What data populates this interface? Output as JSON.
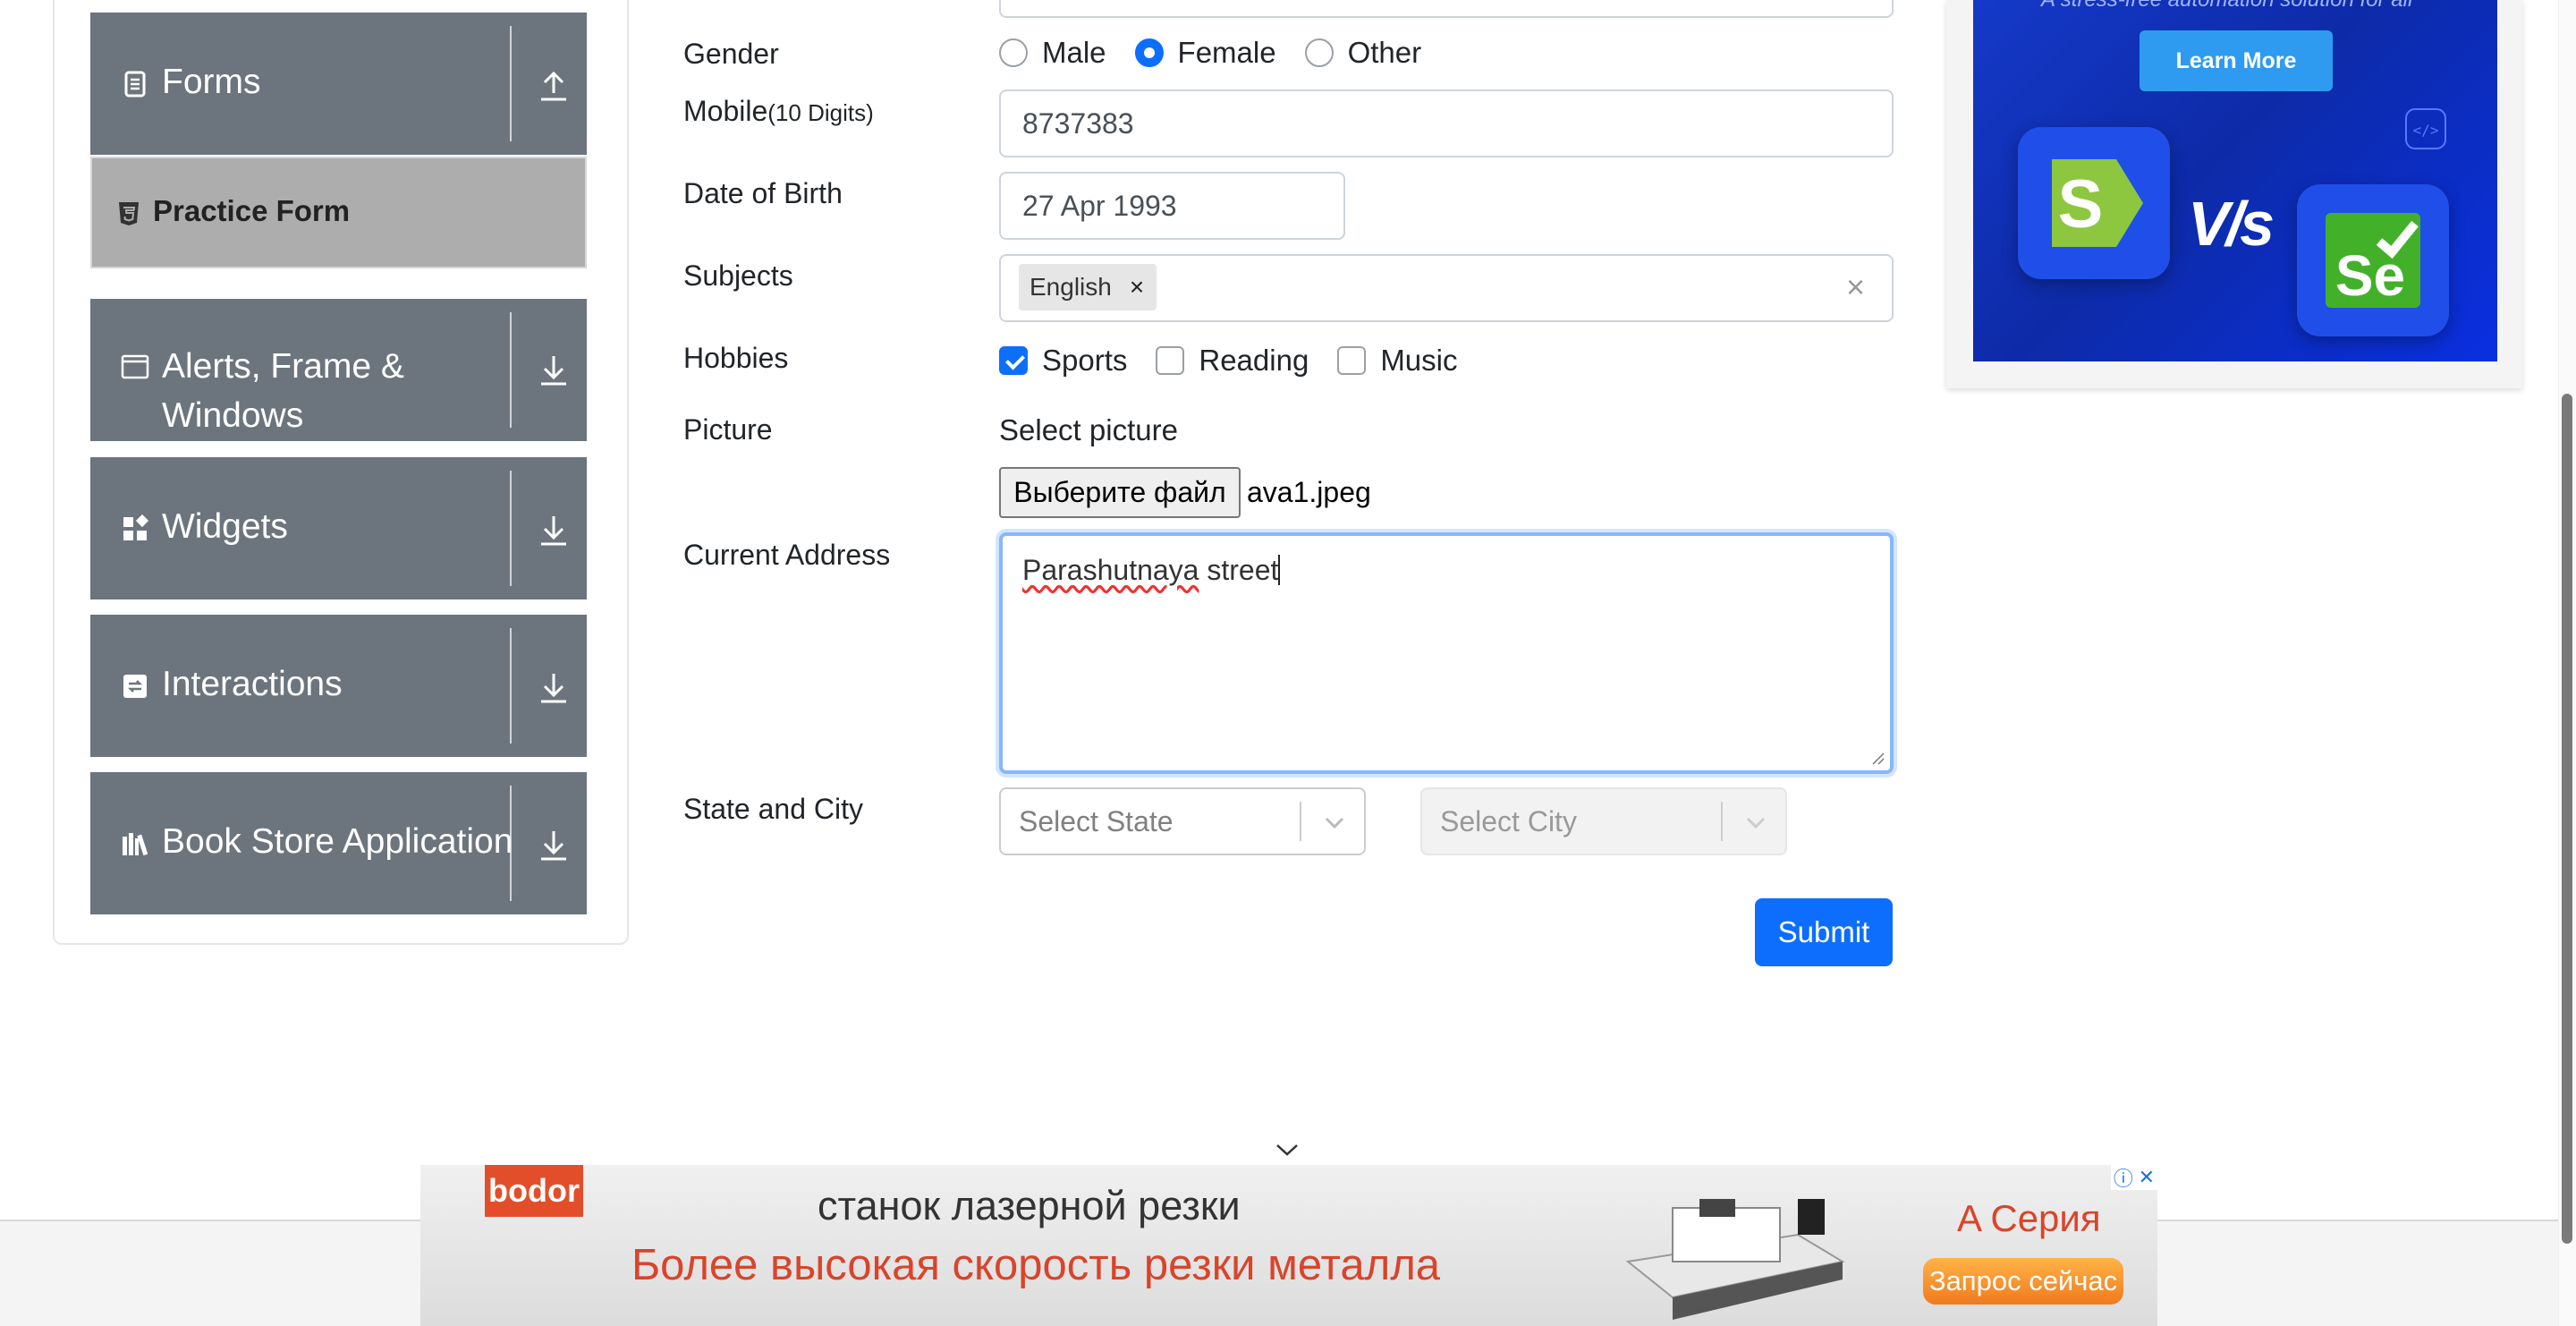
{
  "sidebar": {
    "groups": [
      {
        "id": "forms",
        "label": "Forms",
        "icon": "form-icon",
        "state": "expanded"
      },
      {
        "id": "alerts",
        "label": "Alerts, Frame &",
        "label_line2": "Windows",
        "icon": "window-icon",
        "state": "collapsed"
      },
      {
        "id": "widgets",
        "label": "Widgets",
        "icon": "widgets-icon",
        "state": "collapsed"
      },
      {
        "id": "interactions",
        "label": "Interactions",
        "icon": "interactions-icon",
        "state": "collapsed"
      },
      {
        "id": "bookstore",
        "label": "Book Store Application",
        "icon": "books-icon",
        "state": "collapsed"
      }
    ],
    "active_item": {
      "label": "Practice Form",
      "icon": "html5-icon"
    }
  },
  "form": {
    "gender": {
      "label": "Gender",
      "options": [
        "Male",
        "Female",
        "Other"
      ],
      "selected": "Female"
    },
    "mobile": {
      "label": "Mobile",
      "hint": "(10 Digits)",
      "value": "8737383"
    },
    "dob": {
      "label": "Date of Birth",
      "value": "27 Apr 1993"
    },
    "subjects": {
      "label": "Subjects",
      "chips": [
        "English"
      ],
      "chip_remove": "×",
      "clear": "×"
    },
    "hobbies": {
      "label": "Hobbies",
      "options": [
        {
          "label": "Sports",
          "checked": true
        },
        {
          "label": "Reading",
          "checked": false
        },
        {
          "label": "Music",
          "checked": false
        }
      ]
    },
    "picture": {
      "label": "Picture",
      "prompt": "Select picture",
      "button_label": "Выберите файл",
      "file_name": "ava1.jpeg"
    },
    "address": {
      "label": "Current Address",
      "value_part1": "Parashutnaya",
      "value_part2": " street"
    },
    "state_city": {
      "label": "State and City",
      "state_placeholder": "Select State",
      "city_placeholder": "Select City"
    },
    "submit_label": "Submit"
  },
  "right_ad": {
    "tagline": "A stress-free automation solution for all",
    "button": "Learn More",
    "left_logo": "S",
    "vs": "V/s",
    "right_logo": "Se"
  },
  "bottom_ad": {
    "brand": "bodor",
    "line1": "станок лазерной резки",
    "line2": "Более высокая скорость резки металла",
    "series": "A Серия",
    "cta": "Запрос сейчас",
    "info": "ⓘ",
    "close": "✕"
  },
  "colors": {
    "primary": "#0d6efd",
    "sidebar_group": "#6c757d",
    "active_item": "#adadad",
    "focus_border": "#86b7fe"
  }
}
